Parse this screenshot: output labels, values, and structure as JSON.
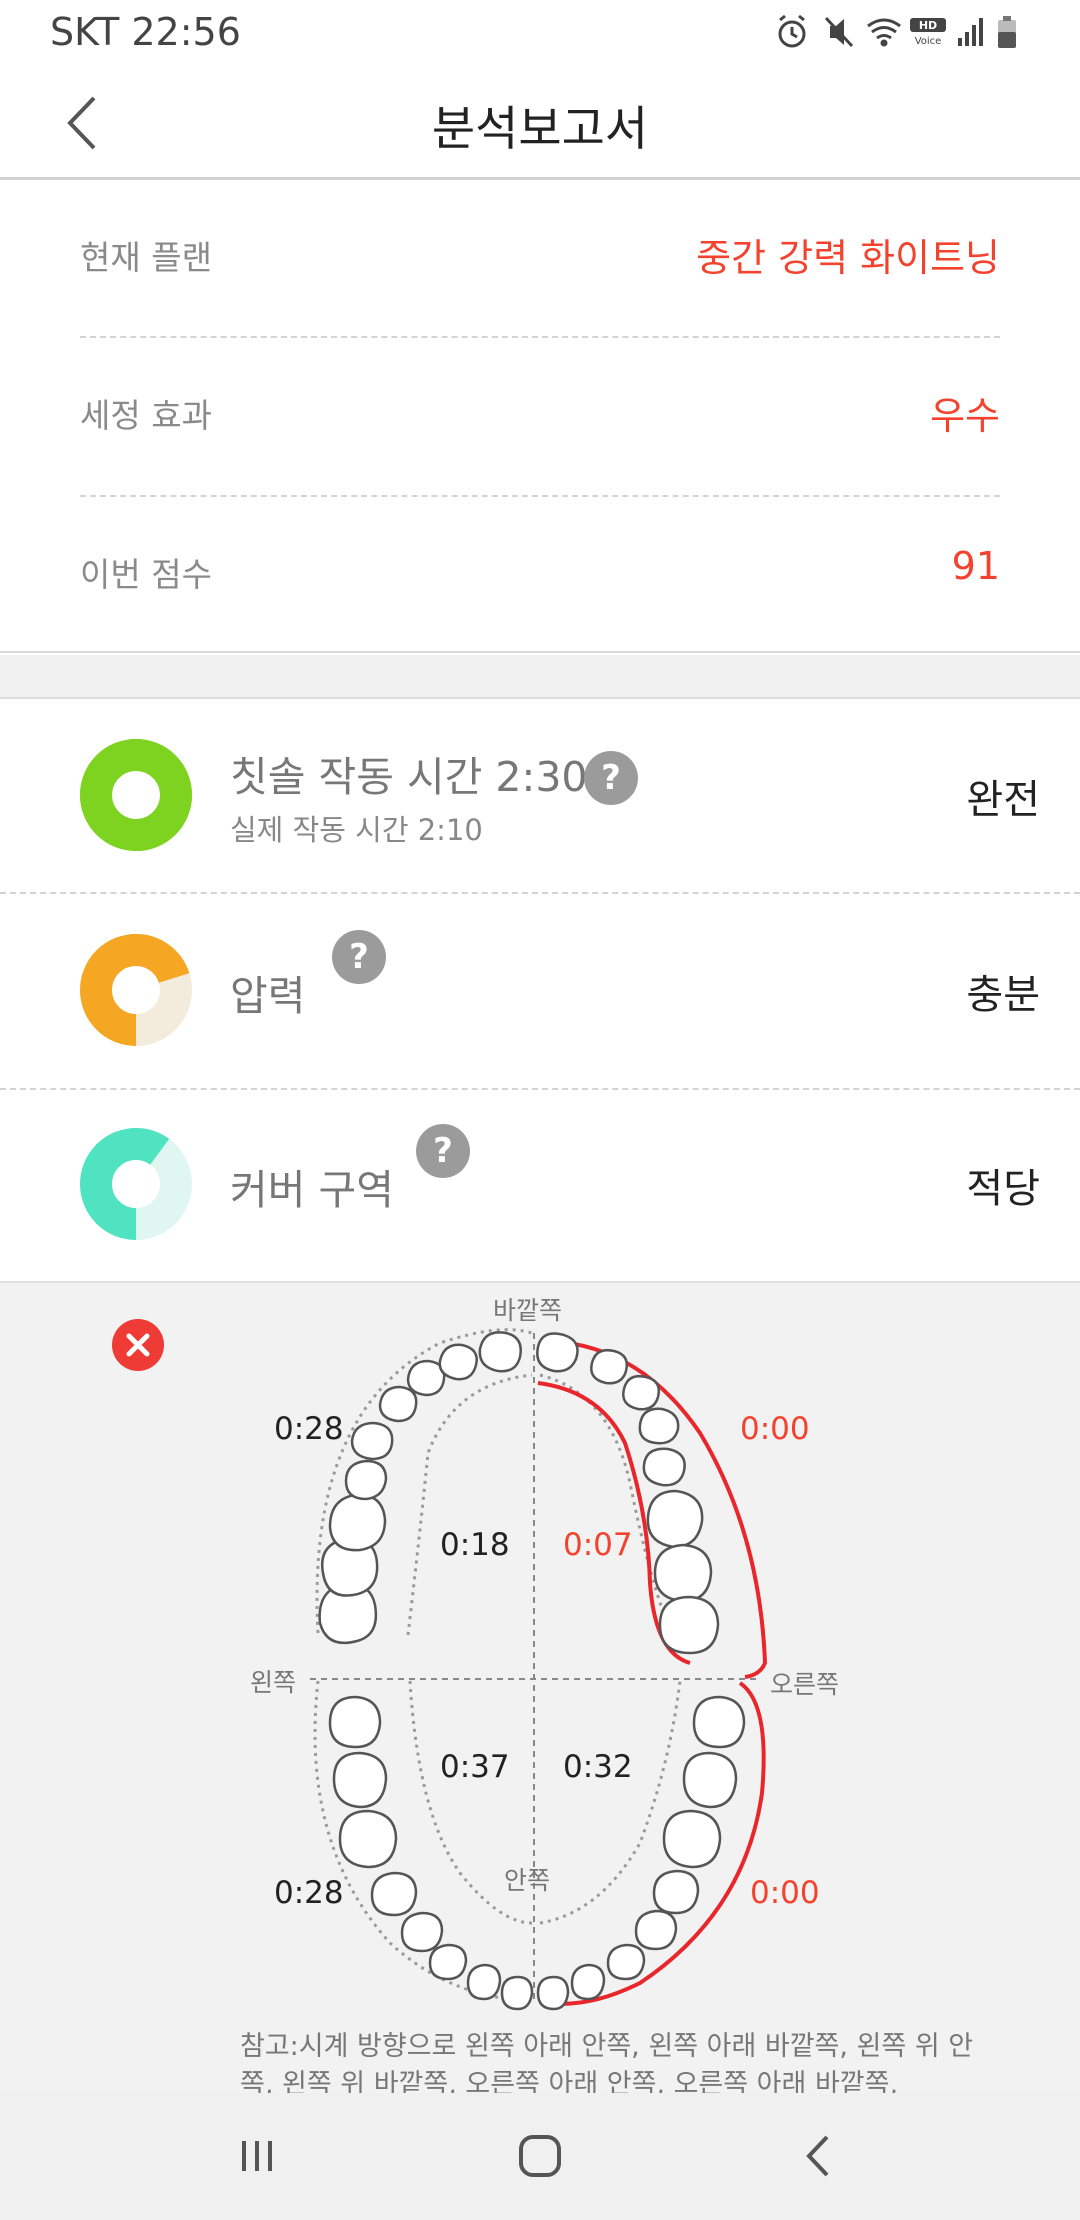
{
  "status_bar": {
    "carrier_time": "SKT 22:56",
    "hd_voice": "HD Voice",
    "icons": [
      "alarm-icon",
      "mute-icon",
      "wifi-icon",
      "hd-voice-icon",
      "signal-icon",
      "battery-icon"
    ]
  },
  "header": {
    "title": "분석보고서",
    "back_icon": "chevron-left-icon"
  },
  "summary": {
    "rows": [
      {
        "label": "현재 플랜",
        "value": "중간 강력 화이트닝"
      },
      {
        "label": "세정 효과",
        "value": "우수"
      },
      {
        "label": "이번 점수",
        "value": "91"
      }
    ]
  },
  "metrics": [
    {
      "label": "칫솔 작동 시간 2:30",
      "sub": "실제 작동 시간 2:10",
      "status": "완전",
      "fill_fraction": 1.0,
      "color": "#7ed321",
      "track": "#7ed321"
    },
    {
      "label": "압력",
      "status": "충분",
      "fill_fraction": 0.7,
      "color": "#f5a623",
      "track": "#f3ecdc"
    },
    {
      "label": "커버 구역",
      "status": "적당",
      "fill_fraction": 0.6,
      "color": "#50e3c2",
      "track": "#dff7f0"
    }
  ],
  "coverage": {
    "directions": {
      "outer": "바깥쪽",
      "inner": "안쪽",
      "left": "왼쪽",
      "right": "오른쪽"
    },
    "zones": {
      "upper_left_outer": "0:28",
      "upper_left_inner": "0:18",
      "upper_right_inner": "0:07",
      "upper_right_outer": "0:00",
      "lower_left_outer": "0:28",
      "lower_left_inner": "0:37",
      "lower_right_inner": "0:32",
      "lower_right_outer": "0:00"
    },
    "note": "참고:시계 방향으로 왼쪽 아래 안쪽, 왼쪽 아래 바깥쪽, 왼쪽 위 안쪽, 왼쪽 위 바깥쪽, 오른쪽 아래 안쪽, 오른쪽 아래 바깥쪽,"
  },
  "colors": {
    "accent_red": "#f3432e",
    "normal_text": "#222222"
  },
  "nav": {
    "icons": [
      "recent-apps-icon",
      "home-icon",
      "back-icon"
    ]
  }
}
